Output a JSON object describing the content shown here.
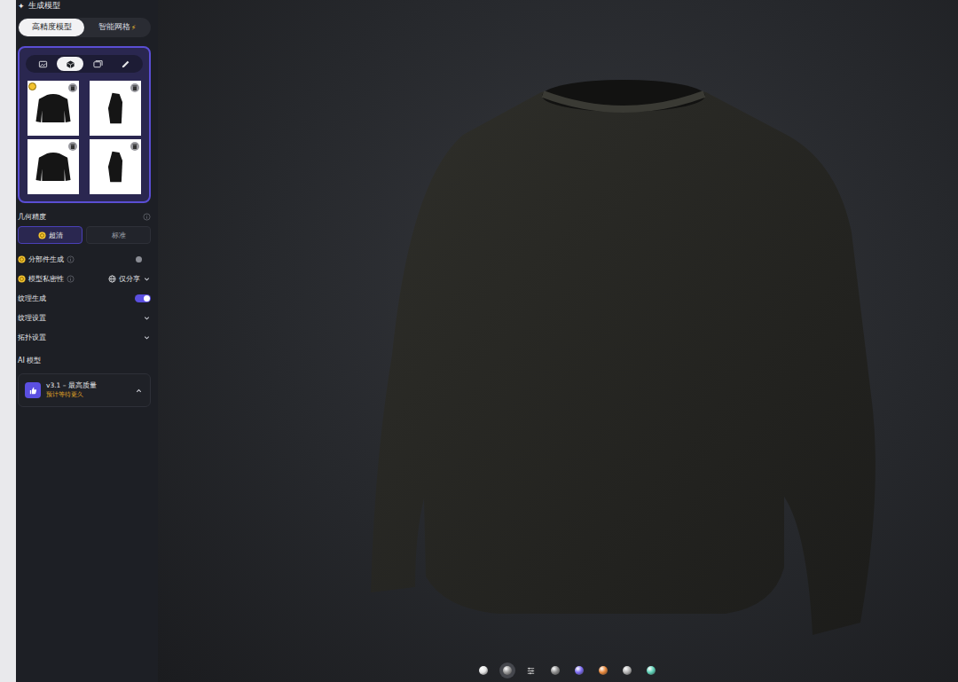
{
  "panel": {
    "title": "生成模型",
    "title_icon": "✦"
  },
  "tabs": [
    {
      "label": "高精度模型",
      "selected": true,
      "icon": ""
    },
    {
      "label": "智能网格",
      "selected": false,
      "icon": "⚡"
    }
  ],
  "input_modes": [
    {
      "kind": "image",
      "selected": false
    },
    {
      "kind": "cube",
      "selected": true
    },
    {
      "kind": "gallery",
      "selected": false
    },
    {
      "kind": "edit",
      "selected": false
    }
  ],
  "thumbnails": [
    {
      "badge": true
    },
    {
      "badge": false
    },
    {
      "badge": false
    },
    {
      "badge": false
    }
  ],
  "geometry": {
    "label": "几何精度",
    "info": true,
    "options": [
      {
        "label": "超清",
        "selected": true,
        "paid": true
      },
      {
        "label": "标准",
        "selected": false,
        "paid": false
      }
    ]
  },
  "settings": [
    {
      "kind": "toggle",
      "label": "分部件生成",
      "paid": true,
      "info": true,
      "on": false
    },
    {
      "kind": "select",
      "label": "模型私密性",
      "paid": true,
      "info": true,
      "value": "仅分享"
    },
    {
      "kind": "toggle",
      "label": "纹理生成",
      "paid": false,
      "info": false,
      "on": true
    },
    {
      "kind": "expand",
      "label": "纹理设置",
      "paid": false,
      "info": false,
      "expanded": false
    },
    {
      "kind": "expand",
      "label": "拓扑设置",
      "paid": false,
      "info": false,
      "expanded": false
    }
  ],
  "ai_model": {
    "label": "AI 模型",
    "name": "v3.1 – 最高质量",
    "note": "预计等待更久",
    "expanded": true
  },
  "materials": [
    {
      "kind": "sphere",
      "color": "#e4e4e4",
      "selected": false
    },
    {
      "kind": "sphere",
      "color": "#9a9a9a",
      "selected": true
    },
    {
      "kind": "sliders",
      "color": "#cfcfcf",
      "selected": false
    },
    {
      "kind": "sphere",
      "color": "#8e8e8e",
      "selected": false
    },
    {
      "kind": "sphere",
      "color": "#7d6cf2",
      "selected": false
    },
    {
      "kind": "sphere",
      "color": "#e8873a",
      "selected": false
    },
    {
      "kind": "sphere",
      "color": "#b4b4b4",
      "selected": false
    },
    {
      "kind": "sphere",
      "color": "#5fd3b8",
      "selected": false
    }
  ]
}
